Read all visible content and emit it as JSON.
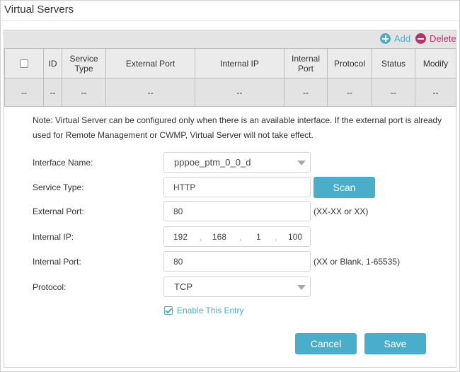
{
  "page": {
    "title": "Virtual Servers"
  },
  "toolbar": {
    "add_label": "Add",
    "delete_label": "Delete"
  },
  "table": {
    "headers": [
      "ID",
      "Service Type",
      "External Port",
      "Internal IP",
      "Internal Port",
      "Protocol",
      "Status",
      "Modify"
    ],
    "empty_row": [
      "--",
      "--",
      "--",
      "--",
      "--",
      "--",
      "--",
      "--",
      "--"
    ]
  },
  "note": "Note: Virtual Server can be configured only when there is an available interface. If the external port is already used for Remote Management or CWMP, Virtual Server will not take effect.",
  "form": {
    "interface_name": {
      "label": "Interface Name:",
      "value": "pppoe_ptm_0_0_d"
    },
    "service_type": {
      "label": "Service Type:",
      "value": "HTTP",
      "scan_label": "Scan"
    },
    "external_port": {
      "label": "External Port:",
      "value": "80",
      "hint": "(XX-XX or XX)"
    },
    "internal_ip": {
      "label": "Internal IP:",
      "octets": [
        "192",
        "168",
        "1",
        "100"
      ]
    },
    "internal_port": {
      "label": "Internal Port:",
      "value": "80",
      "hint": "(XX or Blank, 1-65535)"
    },
    "protocol": {
      "label": "Protocol:",
      "value": "TCP"
    },
    "enable_entry": {
      "label": "Enable This Entry",
      "checked": true
    }
  },
  "actions": {
    "cancel_label": "Cancel",
    "save_label": "Save"
  },
  "colors": {
    "accent": "#4aaecb",
    "delete": "#b8326a"
  }
}
